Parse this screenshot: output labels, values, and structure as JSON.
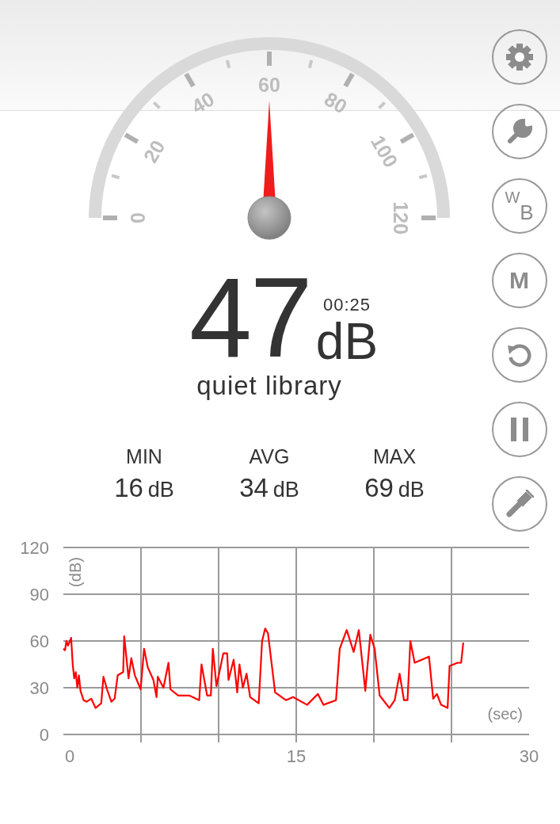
{
  "gauge": {
    "labels": [
      "0",
      "20",
      "40",
      "60",
      "80",
      "100",
      "120"
    ]
  },
  "reading": {
    "value": "47",
    "unit": "dB",
    "timer": "00:25",
    "description": "quiet library"
  },
  "stats": [
    {
      "label": "MIN",
      "value": "16",
      "unit": "dB"
    },
    {
      "label": "AVG",
      "value": "34",
      "unit": "dB"
    },
    {
      "label": "MAX",
      "value": "69",
      "unit": "dB"
    }
  ],
  "side_buttons": [
    {
      "kind": "gear"
    },
    {
      "kind": "wrench"
    },
    {
      "kind": "text",
      "label": "$^{W}$$_{B}$"
    },
    {
      "kind": "text",
      "label": "M"
    },
    {
      "kind": "reset"
    },
    {
      "kind": "pause"
    },
    {
      "kind": "flashlight"
    }
  ],
  "chart": {
    "chart_data": {
      "type": "line",
      "grid": true,
      "ylabel": "(dB)",
      "xlabel": "(sec)",
      "xlim": [
        0,
        30
      ],
      "ylim": [
        0,
        120
      ],
      "xticks": [
        0,
        15,
        30
      ],
      "yticks": [
        0,
        30,
        60,
        90,
        120
      ],
      "x": [
        0,
        0.1,
        0.2,
        0.3,
        0.5,
        0.6,
        0.7,
        0.8,
        0.9,
        1.0,
        1.1,
        1.3,
        1.5,
        1.8,
        2.07,
        2.44,
        2.58,
        2.81,
        3.09,
        3.3,
        3.5,
        3.85,
        3.92,
        4.2,
        4.38,
        4.6,
        4.98,
        5.2,
        5.44,
        5.8,
        6.0,
        6.08,
        6.45,
        6.77,
        6.9,
        7.4,
        8.1,
        8.75,
        8.9,
        9.26,
        9.5,
        9.63,
        9.86,
        10.3,
        10.55,
        10.64,
        10.97,
        11.2,
        11.34,
        11.56,
        11.8,
        12.03,
        12.58,
        12.8,
        13.0,
        13.18,
        13.64,
        14.33,
        14.8,
        15.7,
        16.4,
        16.75,
        17.56,
        17.8,
        18.25,
        18.7,
        19.03,
        19.45,
        19.77,
        20.05,
        20.37,
        21.0,
        21.34,
        21.66,
        21.94,
        22.17,
        22.35,
        22.63,
        23.1,
        23.55,
        23.82,
        24.06,
        24.33,
        24.75,
        24.88,
        25.4,
        25.62,
        25.76
      ],
      "series": [
        {
          "color": "#ff0000",
          "values": [
            55,
            54,
            60,
            57,
            62,
            45,
            36,
            40,
            30,
            38,
            28,
            22,
            21,
            23,
            17,
            20,
            37,
            29,
            21,
            23,
            38,
            40,
            63,
            36,
            49,
            38,
            29,
            55,
            43,
            35,
            24,
            37,
            30,
            46,
            29,
            25,
            25,
            22,
            45,
            25,
            25,
            55,
            31,
            52,
            52,
            35,
            48,
            27,
            45,
            30,
            39,
            24,
            20,
            60,
            68,
            65,
            27,
            22,
            24,
            19,
            26,
            19,
            22,
            55,
            67,
            53,
            67,
            28,
            64,
            55,
            25,
            17,
            22,
            39,
            22,
            22,
            60,
            46,
            48,
            50,
            23,
            26,
            19,
            17,
            44,
            46,
            46,
            59
          ]
        }
      ]
    }
  }
}
